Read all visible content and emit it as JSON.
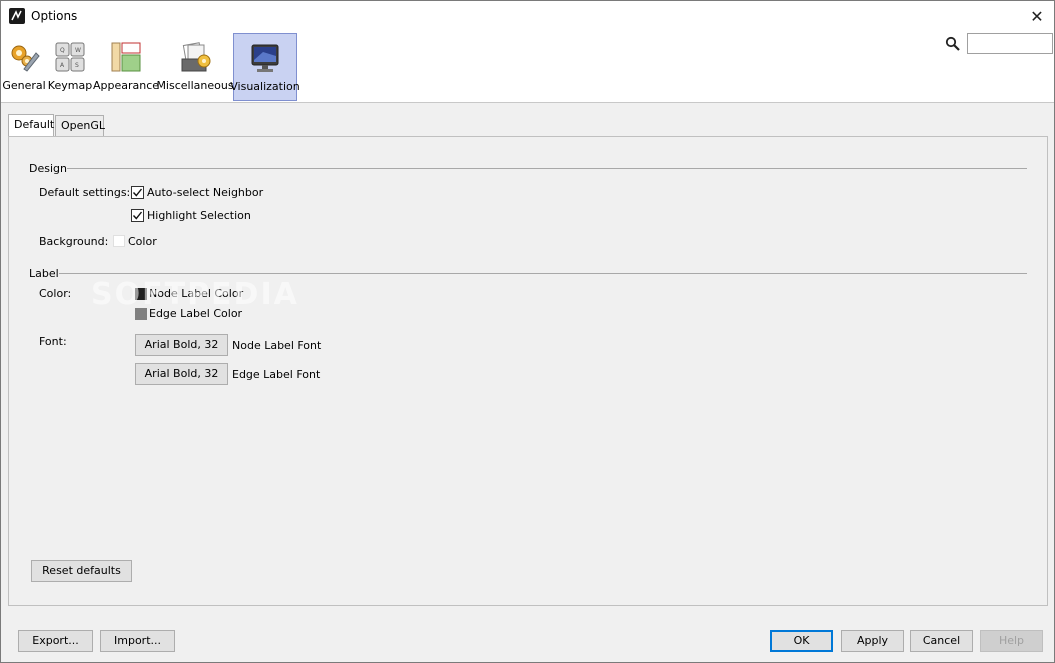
{
  "window": {
    "title": "Options",
    "close": "✕"
  },
  "toolbar": {
    "items": [
      {
        "label": "General",
        "icon": "gears-wrench-icon"
      },
      {
        "label": "Keymap",
        "icon": "keyboard-icon"
      },
      {
        "label": "Appearance",
        "icon": "layout-panels-icon"
      },
      {
        "label": "Miscellaneous",
        "icon": "misc-folder-icon"
      },
      {
        "label": "Visualization",
        "icon": "monitor-icon",
        "selected": true
      }
    ],
    "search": {
      "value": "",
      "placeholder": ""
    }
  },
  "tabs": [
    {
      "label": "Default",
      "active": true
    },
    {
      "label": "OpenGL",
      "active": false
    }
  ],
  "design": {
    "title": "Design",
    "default_settings_label": "Default settings:",
    "auto_select": {
      "label": "Auto-select Neighbor",
      "checked": true
    },
    "highlight": {
      "label": "Highlight Selection",
      "checked": true
    },
    "background_label": "Background:",
    "background_color": {
      "label": "Color",
      "swatch": "#ffffff"
    }
  },
  "label_section": {
    "title": "Label",
    "color_label": "Color:",
    "node_color": {
      "label": "Node Label Color",
      "swatch": "#202020"
    },
    "edge_color": {
      "label": "Edge Label Color",
      "swatch": "#808080"
    },
    "font_label": "Font:",
    "node_font": {
      "button": "Arial Bold, 32",
      "label": "Node Label Font"
    },
    "edge_font": {
      "button": "Arial Bold, 32",
      "label": "Edge Label Font"
    }
  },
  "watermark": "SOFTPEDIA",
  "buttons": {
    "reset": "Reset defaults",
    "export": "Export...",
    "import": "Import...",
    "ok": "OK",
    "apply": "Apply",
    "cancel": "Cancel",
    "help": "Help"
  },
  "colors": {
    "selected_tool_bg": "#c9d2f2",
    "default_button_border": "#0078d7"
  }
}
